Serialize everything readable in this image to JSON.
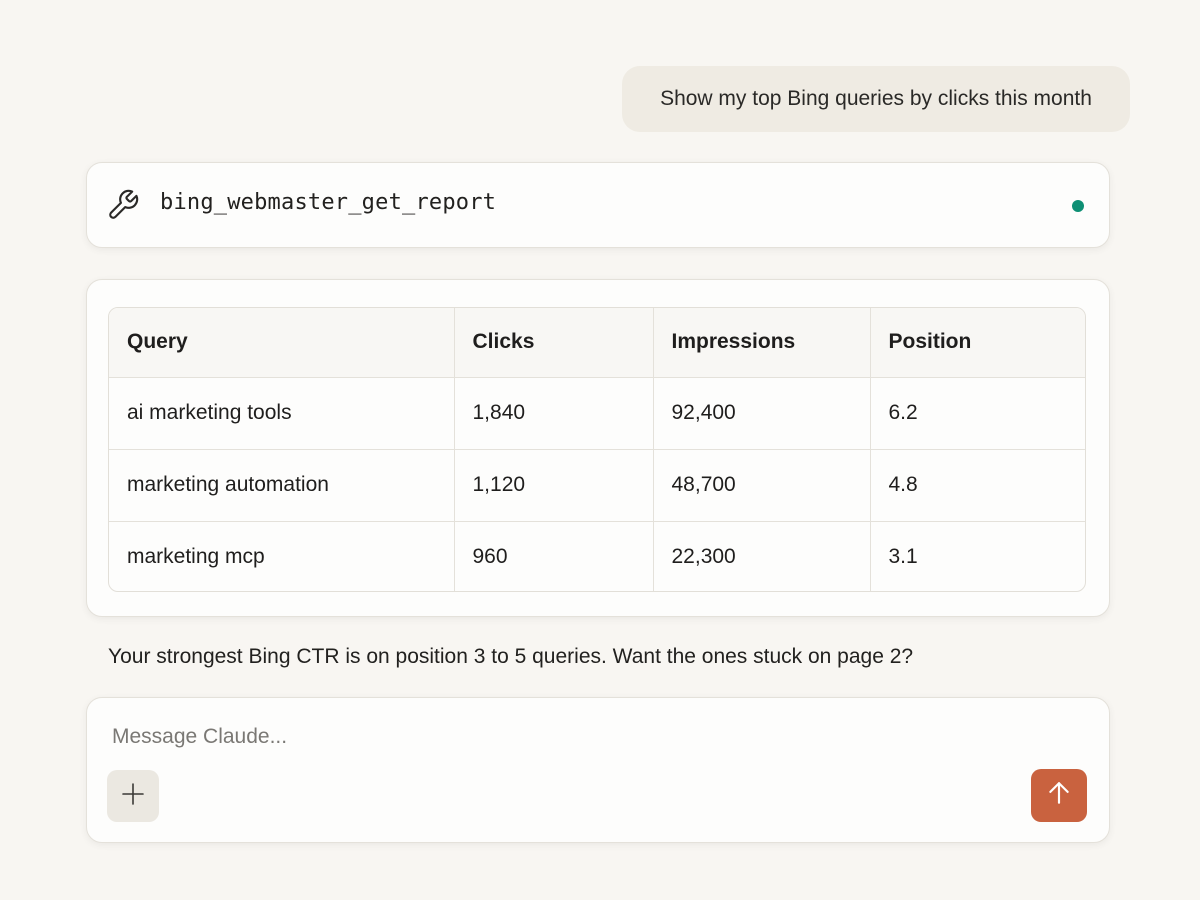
{
  "conversation": {
    "user_message": "Show my top Bing queries by clicks this month",
    "assistant_reply": "Your strongest Bing CTR is on position 3 to 5 queries. Want the ones stuck on page 2?"
  },
  "tool_call": {
    "name": "bing_webmaster_get_report",
    "icon": "wrench-icon",
    "status_color": "#0e8f74"
  },
  "report_table": {
    "headers": [
      "Query",
      "Clicks",
      "Impressions",
      "Position"
    ],
    "rows": [
      [
        "ai marketing tools",
        "1,840",
        "92,400",
        "6.2"
      ],
      [
        "marketing automation",
        "1,120",
        "48,700",
        "4.8"
      ],
      [
        "marketing mcp",
        "960",
        "22,300",
        "3.1"
      ]
    ]
  },
  "composer": {
    "placeholder": "Message Claude...",
    "attach_icon": "plus-icon",
    "send_icon": "arrow-up-icon",
    "send_color": "#c9623f"
  }
}
